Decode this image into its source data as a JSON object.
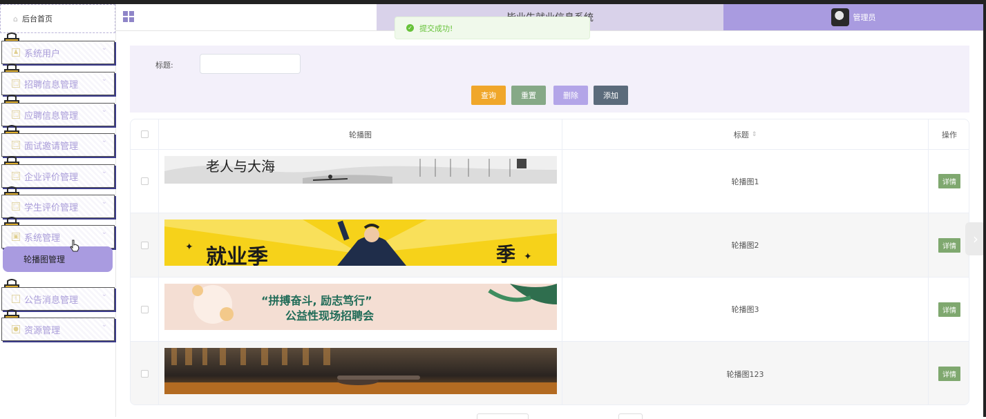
{
  "header": {
    "title": "毕业生就业信息系统",
    "user_label": "管理员"
  },
  "toast": {
    "message": "提交成功!"
  },
  "sidebar": {
    "home_label": "后台首页",
    "menu": [
      {
        "label": "系统用户"
      },
      {
        "label": "招聘信息管理"
      },
      {
        "label": "应聘信息管理"
      },
      {
        "label": "面试邀请管理"
      },
      {
        "label": "企业评价管理"
      },
      {
        "label": "学生评价管理"
      },
      {
        "label": "系统管理"
      },
      {
        "label": "公告消息管理"
      },
      {
        "label": "资源管理"
      }
    ],
    "active_sub_item": "轮播图管理"
  },
  "search": {
    "title_label": "标题:",
    "title_value": "",
    "buttons": {
      "query": "查询",
      "reset": "重置",
      "delete": "删除",
      "add": "添加"
    },
    "button_colors": {
      "query": "#f0a72a",
      "reset": "#86a987",
      "delete": "#b3a5e8",
      "add": "#5b6b7b"
    }
  },
  "table": {
    "headers": {
      "image": "轮播图",
      "title": "标题",
      "action": "操作"
    },
    "rows": [
      {
        "title": "轮播图1",
        "action": "详情",
        "banner_text": "老人与大海"
      },
      {
        "title": "轮播图2",
        "action": "详情",
        "banner_text": "就业季"
      },
      {
        "title": "轮播图3",
        "action": "详情",
        "banner_text_1": "“拼搏奋斗, 励志笃行”",
        "banner_text_2": "公益性现场招聘会"
      },
      {
        "title": "轮播图123",
        "action": "详情"
      }
    ]
  }
}
